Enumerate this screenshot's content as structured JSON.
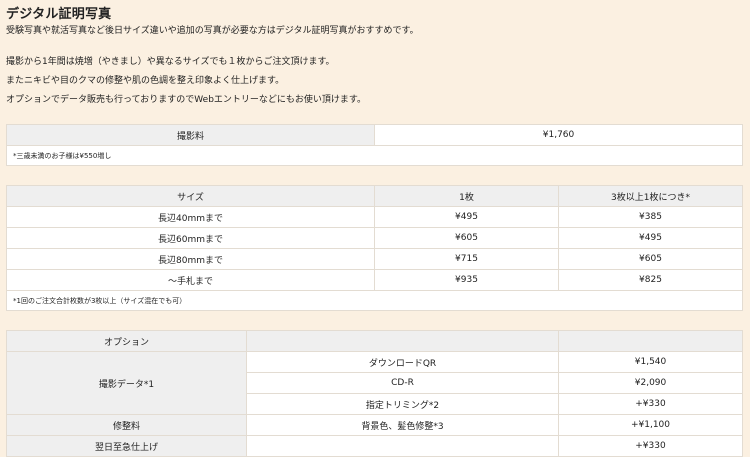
{
  "title": "デジタル証明写真",
  "intro": "受験写真や就活写真など後日サイズ違いや追加の写真が必要な方はデジタル証明写真がおすすめです。",
  "desc": [
    "撮影から1年間は焼増（やきまし）や異なるサイズでも１枚からご注文頂けます。",
    "またニキビや目のクマの修整や肌の色調を整え印象よく仕上げます。",
    "オプションでデータ販売も行っておりますのでWebエントリーなどにもお使い頂けます。"
  ],
  "fee_table": {
    "label": "撮影料",
    "value": "¥1,760",
    "note": "*三歳未満のお子様は¥550増し"
  },
  "size_table": {
    "headers": [
      "サイズ",
      "1枚",
      "3枚以上1枚につき*"
    ],
    "rows": [
      [
        "長辺40mmまで",
        "¥495",
        "¥385"
      ],
      [
        "長辺60mmまで",
        "¥605",
        "¥495"
      ],
      [
        "長辺80mmまで",
        "¥715",
        "¥605"
      ],
      [
        "〜手札まで",
        "¥935",
        "¥825"
      ]
    ],
    "note": "*1回のご注文合計枚数が3枚以上（サイズ混在でも可）"
  },
  "option_table": {
    "header": "オプション",
    "data_label": "撮影データ*1",
    "data_rows": [
      [
        "ダウンロードQR",
        "¥1,540"
      ],
      [
        "CD-R",
        "¥2,090"
      ],
      [
        "指定トリミング*2",
        "+¥330"
      ]
    ],
    "retouch_label": "修整料",
    "retouch_item": "背景色、髪色修整*3",
    "retouch_price": "+¥1,100",
    "rush_label": "翌日至急仕上げ",
    "rush_price": "+¥330"
  }
}
